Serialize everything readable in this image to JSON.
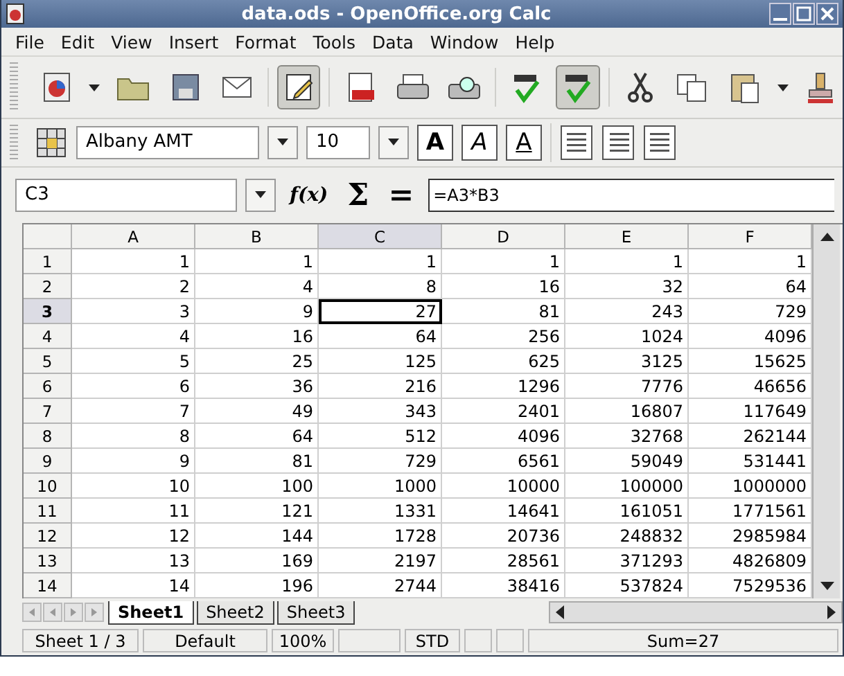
{
  "window": {
    "title": "data.ods - OpenOffice.org Calc"
  },
  "menu": [
    "File",
    "Edit",
    "View",
    "Insert",
    "Format",
    "Tools",
    "Data",
    "Window",
    "Help"
  ],
  "toolbar": [
    {
      "kind": "new",
      "pressed": false
    },
    {
      "kind": "dropdown"
    },
    {
      "kind": "open",
      "pressed": false
    },
    {
      "kind": "save",
      "pressed": false
    },
    {
      "kind": "mail",
      "pressed": false
    },
    {
      "kind": "sep"
    },
    {
      "kind": "edit",
      "pressed": true
    },
    {
      "kind": "sep"
    },
    {
      "kind": "pdf",
      "pressed": false
    },
    {
      "kind": "print",
      "pressed": false
    },
    {
      "kind": "preview",
      "pressed": false
    },
    {
      "kind": "sep"
    },
    {
      "kind": "spell",
      "pressed": false
    },
    {
      "kind": "spell",
      "pressed": true
    },
    {
      "kind": "sep"
    },
    {
      "kind": "cut",
      "pressed": false
    },
    {
      "kind": "copy",
      "pressed": false
    },
    {
      "kind": "paste",
      "pressed": false
    },
    {
      "kind": "dropdown"
    },
    {
      "kind": "brush",
      "pressed": false
    }
  ],
  "format_bar": {
    "font": "Albany AMT",
    "size": "10",
    "styles": [
      {
        "kind": "bold",
        "glyph": "A"
      },
      {
        "kind": "italic",
        "glyph": "A"
      },
      {
        "kind": "underline",
        "glyph": "A"
      }
    ]
  },
  "formula_bar": {
    "cell": "C3",
    "function_glyph": "f(x)",
    "sum_glyph": "Σ",
    "equals_glyph": "=",
    "formula": "=A3*B3"
  },
  "grid": {
    "columns": [
      {
        "label": "A",
        "selected": false
      },
      {
        "label": "B",
        "selected": false
      },
      {
        "label": "C",
        "selected": true
      },
      {
        "label": "D",
        "selected": false
      },
      {
        "label": "E",
        "selected": false
      },
      {
        "label": "F",
        "selected": false
      }
    ],
    "rows": [
      {
        "label": "1",
        "selected": false,
        "cells": [
          "1",
          "1",
          "1",
          "1",
          "1",
          "1"
        ]
      },
      {
        "label": "2",
        "selected": false,
        "cells": [
          "2",
          "4",
          "8",
          "16",
          "32",
          "64"
        ]
      },
      {
        "label": "3",
        "selected": true,
        "cells": [
          "3",
          "9",
          "27",
          "81",
          "243",
          "729"
        ]
      },
      {
        "label": "4",
        "selected": false,
        "cells": [
          "4",
          "16",
          "64",
          "256",
          "1024",
          "4096"
        ]
      },
      {
        "label": "5",
        "selected": false,
        "cells": [
          "5",
          "25",
          "125",
          "625",
          "3125",
          "15625"
        ]
      },
      {
        "label": "6",
        "selected": false,
        "cells": [
          "6",
          "36",
          "216",
          "1296",
          "7776",
          "46656"
        ]
      },
      {
        "label": "7",
        "selected": false,
        "cells": [
          "7",
          "49",
          "343",
          "2401",
          "16807",
          "117649"
        ]
      },
      {
        "label": "8",
        "selected": false,
        "cells": [
          "8",
          "64",
          "512",
          "4096",
          "32768",
          "262144"
        ]
      },
      {
        "label": "9",
        "selected": false,
        "cells": [
          "9",
          "81",
          "729",
          "6561",
          "59049",
          "531441"
        ]
      },
      {
        "label": "10",
        "selected": false,
        "cells": [
          "10",
          "100",
          "1000",
          "10000",
          "100000",
          "1000000"
        ]
      },
      {
        "label": "11",
        "selected": false,
        "cells": [
          "11",
          "121",
          "1331",
          "14641",
          "161051",
          "1771561"
        ]
      },
      {
        "label": "12",
        "selected": false,
        "cells": [
          "12",
          "144",
          "1728",
          "20736",
          "248832",
          "2985984"
        ]
      },
      {
        "label": "13",
        "selected": false,
        "cells": [
          "13",
          "169",
          "2197",
          "28561",
          "371293",
          "4826809"
        ]
      },
      {
        "label": "14",
        "selected": false,
        "cells": [
          "14",
          "196",
          "2744",
          "38416",
          "537824",
          "7529536"
        ]
      }
    ]
  },
  "sheet_tabs": [
    {
      "label": "Sheet1",
      "selected": true
    },
    {
      "label": "Sheet2",
      "selected": false
    },
    {
      "label": "Sheet3",
      "selected": false
    }
  ],
  "status_bar": [
    {
      "kind": "text",
      "text": "Sheet 1 / 3"
    },
    {
      "kind": "text",
      "text": "Default"
    },
    {
      "kind": "text",
      "text": "100%"
    },
    {
      "kind": "blank"
    },
    {
      "kind": "text",
      "text": "STD"
    },
    {
      "kind": "blank"
    },
    {
      "kind": "blank"
    },
    {
      "kind": "text",
      "text": "Sum=27"
    }
  ]
}
